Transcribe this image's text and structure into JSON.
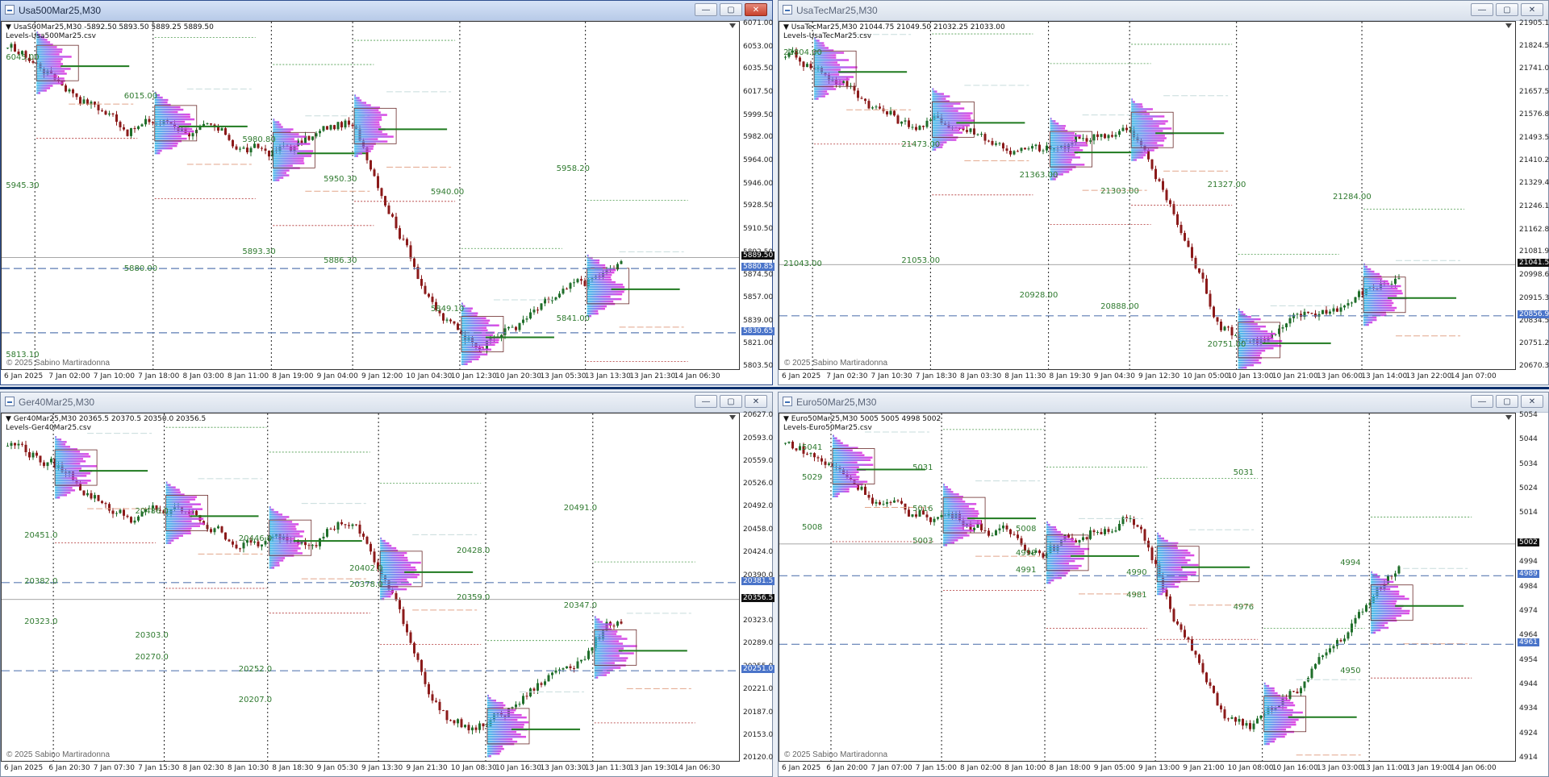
{
  "colors": {
    "bull": "#1f6e2a",
    "bear": "#8b1a1a",
    "vline": "#333333",
    "poc": "#1f7a1f",
    "dashedBlue": "#5b7bb3",
    "tagBlue": "#4a74c9",
    "tagDark": "#111111",
    "levelGreen": "#2f7a2f"
  },
  "windows": [
    {
      "id": "w1",
      "title": "Usa500Mar25,M30",
      "active": true,
      "info1": "UsaS00Mar25,M30 -5892.50 5893.50 5889.25 5889.50",
      "info2": "Levels-Usa500Mar25.csv",
      "copyright": "© 2025 Sabino Martiradonna",
      "y_labels": [
        "6071.00",
        "6053.00",
        "6035.50",
        "6017.50",
        "5999.50",
        "5982.00",
        "5964.00",
        "5946.00",
        "5928.50",
        "5910.50",
        "5892.50",
        "5874.50",
        "5857.00",
        "5839.00",
        "5821.00",
        "5803.50"
      ],
      "y_min": 5803.5,
      "y_max": 6071.0,
      "x_labels": [
        "6 Jan 2025",
        "7 Jan 02:00",
        "7 Jan 10:00",
        "7 Jan 18:00",
        "8 Jan 03:00",
        "8 Jan 11:00",
        "8 Jan 19:00",
        "9 Jan 04:00",
        "9 Jan 12:00",
        "10 Jan 04:30",
        "10 Jan 12:30",
        "10 Jan 20:30",
        "13 Jan 05:30",
        "13 Jan 13:30",
        "13 Jan 21:30",
        "14 Jan 06:30"
      ],
      "tags": [
        {
          "text": "5889.50",
          "price": 5889.5,
          "kind": "dark"
        },
        {
          "text": "5880.85",
          "price": 5880.85,
          "kind": "blue"
        },
        {
          "text": "5830.65",
          "price": 5830.65,
          "kind": "blue"
        }
      ],
      "levels": [
        {
          "text": "6045.00",
          "price": 6045
        },
        {
          "text": "6015.00",
          "price": 6015
        },
        {
          "text": "5980.80",
          "price": 5980.8
        },
        {
          "text": "5950.30",
          "price": 5950.3
        },
        {
          "text": "5940.00",
          "price": 5940
        },
        {
          "text": "5958.20",
          "price": 5958.2
        },
        {
          "text": "5945.30",
          "price": 5945.3
        },
        {
          "text": "5880.00",
          "price": 5880
        },
        {
          "text": "5893.30",
          "price": 5893.3
        },
        {
          "text": "5886.30",
          "price": 5886.3
        },
        {
          "text": "5849.10",
          "price": 5849.1
        },
        {
          "text": "5841.00",
          "price": 5841
        },
        {
          "text": "5813.10",
          "price": 5813.1
        }
      ],
      "vlines": [
        0.045,
        0.205,
        0.365,
        0.475,
        0.62,
        0.79
      ]
    },
    {
      "id": "w2",
      "title": "UsaTecMar25,M30",
      "active": false,
      "info1": "UsaTecMar25,M30 21044.75 21049.50 21032.25 21033.00",
      "info2": "Levels-UsaTecMar25.csv",
      "copyright": "© 2025 Sabino Martiradonna",
      "y_labels": [
        "21905.15",
        "21824.50",
        "21741.00",
        "21657.50",
        "21576.85",
        "21493.55",
        "21410.25",
        "21329.40",
        "21246.10",
        "21162.80",
        "21081.95",
        "20998.65",
        "20915.35",
        "20834.50",
        "20751.20",
        "20670.35"
      ],
      "y_min": 20670.35,
      "y_max": 21905.15,
      "x_labels": [
        "6 Jan 2025",
        "7 Jan 02:30",
        "7 Jan 10:30",
        "7 Jan 18:30",
        "8 Jan 03:30",
        "8 Jan 11:30",
        "8 Jan 19:30",
        "9 Jan 04:30",
        "9 Jan 12:30",
        "10 Jan 05:00",
        "10 Jan 13:00",
        "10 Jan 21:00",
        "13 Jan 06:00",
        "13 Jan 14:00",
        "13 Jan 22:00",
        "14 Jan 07:00"
      ],
      "tags": [
        {
          "text": "21041.53",
          "price": 21041.53,
          "kind": "dark"
        },
        {
          "text": "20856.90",
          "price": 20856.9,
          "kind": "blue"
        }
      ],
      "levels": [
        {
          "text": "21804.00",
          "price": 21804
        },
        {
          "text": "21473.00",
          "price": 21473
        },
        {
          "text": "21363.00",
          "price": 21363
        },
        {
          "text": "21303.00",
          "price": 21303
        },
        {
          "text": "21327.00",
          "price": 21327
        },
        {
          "text": "21284.00",
          "price": 21284
        },
        {
          "text": "21043.00",
          "price": 21043
        },
        {
          "text": "21053.00",
          "price": 21053
        },
        {
          "text": "20928.00",
          "price": 20928
        },
        {
          "text": "20888.00",
          "price": 20888
        },
        {
          "text": "20751.00",
          "price": 20751
        }
      ],
      "vlines": [
        0.045,
        0.205,
        0.365,
        0.475,
        0.62,
        0.79
      ]
    },
    {
      "id": "w3",
      "title": "Ger40Mar25,M30",
      "active": false,
      "info1": "Ger40Mar25,M30 20365.5 20370.5 20350.0 20356.5",
      "info2": "Levels-Ger40Mar25.csv",
      "copyright": "© 2025 Sabino Martiradonna",
      "y_labels": [
        "20627.0",
        "20593.0",
        "20559.0",
        "20526.0",
        "20492.0",
        "20458.0",
        "20424.0",
        "20390.0",
        "20356.5",
        "20323.0",
        "20289.0",
        "20255.0",
        "20221.0",
        "20187.0",
        "20153.0",
        "20120.0"
      ],
      "y_min": 20120.0,
      "y_max": 20627.0,
      "x_labels": [
        "6 Jan 2025",
        "6 Jan 20:30",
        "7 Jan 07:30",
        "7 Jan 15:30",
        "8 Jan 02:30",
        "8 Jan 10:30",
        "8 Jan 18:30",
        "9 Jan 05:30",
        "9 Jan 13:30",
        "9 Jan 21:30",
        "10 Jan 08:30",
        "10 Jan 16:30",
        "13 Jan 03:30",
        "13 Jan 11:30",
        "13 Jan 19:30",
        "14 Jan 06:30"
      ],
      "tags": [
        {
          "text": "20381.5",
          "price": 20381.5,
          "kind": "blue"
        },
        {
          "text": "20356.5",
          "price": 20356.5,
          "kind": "dark"
        },
        {
          "text": "20251.0",
          "price": 20251.0,
          "kind": "blue"
        }
      ],
      "levels": [
        {
          "text": "20451.0",
          "price": 20451
        },
        {
          "text": "20486.0",
          "price": 20486
        },
        {
          "text": "20446.0",
          "price": 20446
        },
        {
          "text": "20402.0",
          "price": 20402
        },
        {
          "text": "20428.0",
          "price": 20428
        },
        {
          "text": "20491.0",
          "price": 20491
        },
        {
          "text": "20382.0",
          "price": 20382
        },
        {
          "text": "20270.0",
          "price": 20270
        },
        {
          "text": "20252.0",
          "price": 20252
        },
        {
          "text": "20378.0",
          "price": 20378
        },
        {
          "text": "20359.0",
          "price": 20359
        },
        {
          "text": "20347.0",
          "price": 20347
        },
        {
          "text": "20323.0",
          "price": 20323
        },
        {
          "text": "20303.0",
          "price": 20303
        },
        {
          "text": "20207.0",
          "price": 20207
        }
      ],
      "vlines": [
        0.07,
        0.22,
        0.36,
        0.51,
        0.655,
        0.8
      ]
    },
    {
      "id": "w4",
      "title": "Euro50Mar25,M30",
      "active": false,
      "info1": "Euro50Mar25,M30 5005 5005 4998 5002",
      "info2": "Levels-Euro50Mar25.csv",
      "copyright": "© 2025 Sabino Martiradonna",
      "y_labels": [
        "5054",
        "5044",
        "5034",
        "5024",
        "5014",
        "5002",
        "4994",
        "4984",
        "4974",
        "4964",
        "4954",
        "4944",
        "4934",
        "4924",
        "4914"
      ],
      "y_min": 4914,
      "y_max": 5054,
      "x_labels": [
        "6 Jan 2025",
        "6 Jan 20:00",
        "7 Jan 07:00",
        "7 Jan 15:00",
        "8 Jan 02:00",
        "8 Jan 10:00",
        "8 Jan 18:00",
        "9 Jan 05:00",
        "9 Jan 13:00",
        "9 Jan 21:00",
        "10 Jan 08:00",
        "10 Jan 16:00",
        "13 Jan 03:00",
        "13 Jan 11:00",
        "13 Jan 19:00",
        "14 Jan 06:00"
      ],
      "tags": [
        {
          "text": "5002",
          "price": 5002,
          "kind": "dark"
        },
        {
          "text": "4989",
          "price": 4989,
          "kind": "blue"
        },
        {
          "text": "4961",
          "price": 4961,
          "kind": "blue"
        }
      ],
      "levels": [
        {
          "text": "5029",
          "price": 5029
        },
        {
          "text": "5016",
          "price": 5016
        },
        {
          "text": "4991",
          "price": 4991
        },
        {
          "text": "4981",
          "price": 4981
        },
        {
          "text": "5031",
          "price": 5031
        },
        {
          "text": "4994",
          "price": 4994
        },
        {
          "text": "5041",
          "price": 5041
        },
        {
          "text": "5031",
          "price": 5033
        },
        {
          "text": "5008",
          "price": 5008
        },
        {
          "text": "4990",
          "price": 4990
        },
        {
          "text": "4976",
          "price": 4976
        },
        {
          "text": "4950",
          "price": 4950
        },
        {
          "text": "5008",
          "price": 5008.5
        },
        {
          "text": "5003",
          "price": 5003
        },
        {
          "text": "4998",
          "price": 4998
        }
      ],
      "vlines": [
        0.07,
        0.22,
        0.36,
        0.51,
        0.655,
        0.8
      ]
    }
  ]
}
